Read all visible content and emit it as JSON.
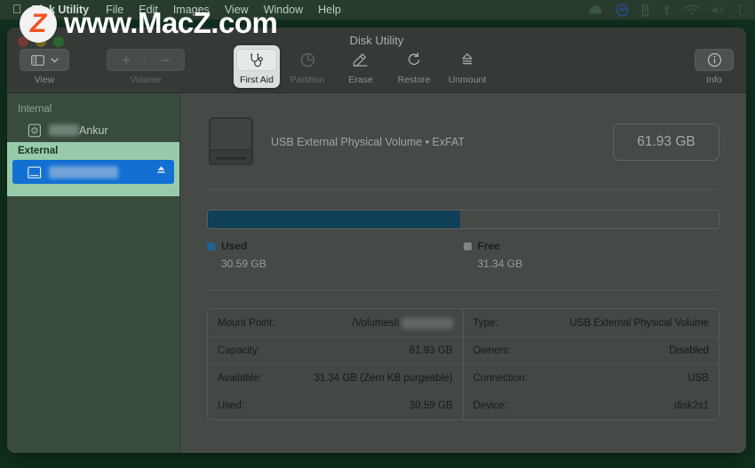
{
  "menubar": {
    "apple_icon": "apple-logo-icon",
    "items": [
      {
        "label": "Disk Utility",
        "bold": true
      },
      {
        "label": "File"
      },
      {
        "label": "Edit"
      },
      {
        "label": "Images"
      },
      {
        "label": "View"
      },
      {
        "label": "Window"
      },
      {
        "label": "Help"
      }
    ],
    "status_icons": [
      "cloud-icon",
      "activity-circle-icon",
      "battery-icon",
      "bluetooth-icon",
      "wifi-icon",
      "volume-icon",
      "control-center-icon"
    ]
  },
  "watermark": {
    "badge_letter": "Z",
    "text": "www.MacZ.com"
  },
  "window": {
    "title": "Disk Utility"
  },
  "toolbar": {
    "view": {
      "label": "View",
      "icon": "sidebar-icon",
      "chevron": "chevron-down-icon"
    },
    "volume": {
      "label": "Volume",
      "add_icon": "plus-icon",
      "remove_icon": "minus-icon"
    },
    "actions": [
      {
        "label": "First Aid",
        "icon": "stethoscope-icon",
        "enabled": true,
        "highlighted": true
      },
      {
        "label": "Partition",
        "icon": "pie-chart-icon",
        "enabled": false,
        "highlighted": false
      },
      {
        "label": "Erase",
        "icon": "erase-icon",
        "enabled": true,
        "highlighted": false
      },
      {
        "label": "Restore",
        "icon": "restore-icon",
        "enabled": true,
        "highlighted": false
      },
      {
        "label": "Unmount",
        "icon": "eject-icon",
        "enabled": true,
        "highlighted": false
      }
    ],
    "info": {
      "label": "Info",
      "icon": "info-circle-icon"
    }
  },
  "sidebar": {
    "sections": [
      {
        "title": "Internal",
        "rows": [
          {
            "name": "Ankur",
            "redacted_prefix": true,
            "icon": "internal-disk-icon",
            "selected": false
          }
        ]
      },
      {
        "title": "External",
        "highlighted": true,
        "rows": [
          {
            "name": "",
            "redacted": true,
            "icon": "external-disk-icon",
            "selected": true,
            "eject_icon": "eject-icon"
          }
        ]
      }
    ]
  },
  "volume": {
    "icon": "external-drive-icon",
    "name_redacted": true,
    "subtitle": "USB External Physical Volume • ExFAT",
    "capacity_badge": "61.93 GB"
  },
  "usage": {
    "used_percent": 49.4,
    "legend": [
      {
        "label": "Used",
        "value": "30.59 GB",
        "color": "#1f6aa5"
      },
      {
        "label": "Free",
        "value": "31.34 GB",
        "color": "#8f8f8f"
      }
    ]
  },
  "details": {
    "left": [
      {
        "key": "Mount Point:",
        "value": "/Volumes/i",
        "redacted_suffix": true
      },
      {
        "key": "Capacity:",
        "value": "61.93 GB"
      },
      {
        "key": "Available:",
        "value": "31.34 GB (Zero KB purgeable)"
      },
      {
        "key": "Used:",
        "value": "30.59 GB"
      }
    ],
    "right": [
      {
        "key": "Type:",
        "value": "USB External Physical Volume"
      },
      {
        "key": "Owners:",
        "value": "Disabled"
      },
      {
        "key": "Connection:",
        "value": "USB"
      },
      {
        "key": "Device:",
        "value": "disk2s1"
      }
    ]
  },
  "colors": {
    "desktop": "#0d2318",
    "window": "#4c4c4c",
    "sidebar": "#3d4d41",
    "selection": "#1376e8",
    "highlight": "#a8dcbb",
    "bar_used": "#10405f",
    "watermark_accent": "#f4511e"
  }
}
